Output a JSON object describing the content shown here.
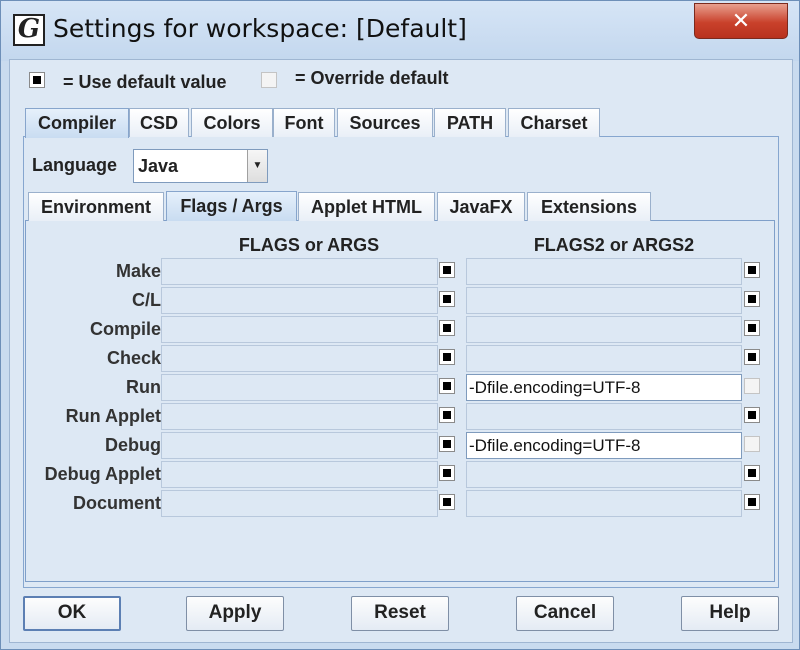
{
  "window": {
    "title": "Settings for workspace: [Default]",
    "app_icon_letter": "G",
    "close_symbol": "✕"
  },
  "legend": {
    "use_default_label": "= Use default value",
    "override_label": "= Override default"
  },
  "top_tabs": [
    {
      "label": "Compiler",
      "selected": true
    },
    {
      "label": "CSD",
      "selected": false
    },
    {
      "label": "Colors",
      "selected": false
    },
    {
      "label": "Font",
      "selected": false
    },
    {
      "label": "Sources",
      "selected": false
    },
    {
      "label": "PATH",
      "selected": false
    },
    {
      "label": "Charset",
      "selected": false
    }
  ],
  "language": {
    "label": "Language",
    "value": "Java",
    "dropdown_icon": "▼"
  },
  "sub_tabs": [
    {
      "label": "Environment",
      "selected": false
    },
    {
      "label": "Flags / Args",
      "selected": true
    },
    {
      "label": "Applet HTML",
      "selected": false
    },
    {
      "label": "JavaFX",
      "selected": false
    },
    {
      "label": "Extensions",
      "selected": false
    }
  ],
  "columns": {
    "col1": "FLAGS or ARGS",
    "col2": "FLAGS2 or ARGS2"
  },
  "rows": [
    {
      "label": "Make",
      "flags": "",
      "flags_default": true,
      "flags2": "",
      "flags2_default": true
    },
    {
      "label": "C/L",
      "flags": "",
      "flags_default": true,
      "flags2": "",
      "flags2_default": true
    },
    {
      "label": "Compile",
      "flags": "",
      "flags_default": true,
      "flags2": "",
      "flags2_default": true
    },
    {
      "label": "Check",
      "flags": "",
      "flags_default": true,
      "flags2": "",
      "flags2_default": true
    },
    {
      "label": "Run",
      "flags": "",
      "flags_default": true,
      "flags2": "-Dfile.encoding=UTF-8",
      "flags2_default": false
    },
    {
      "label": "Run Applet",
      "flags": "",
      "flags_default": true,
      "flags2": "",
      "flags2_default": true
    },
    {
      "label": "Debug",
      "flags": "",
      "flags_default": true,
      "flags2": "-Dfile.encoding=UTF-8",
      "flags2_default": false
    },
    {
      "label": "Debug Applet",
      "flags": "",
      "flags_default": true,
      "flags2": "",
      "flags2_default": true
    },
    {
      "label": "Document",
      "flags": "",
      "flags_default": true,
      "flags2": "",
      "flags2_default": true
    }
  ],
  "buttons": {
    "ok": "OK",
    "apply": "Apply",
    "reset": "Reset",
    "cancel": "Cancel",
    "help": "Help"
  }
}
